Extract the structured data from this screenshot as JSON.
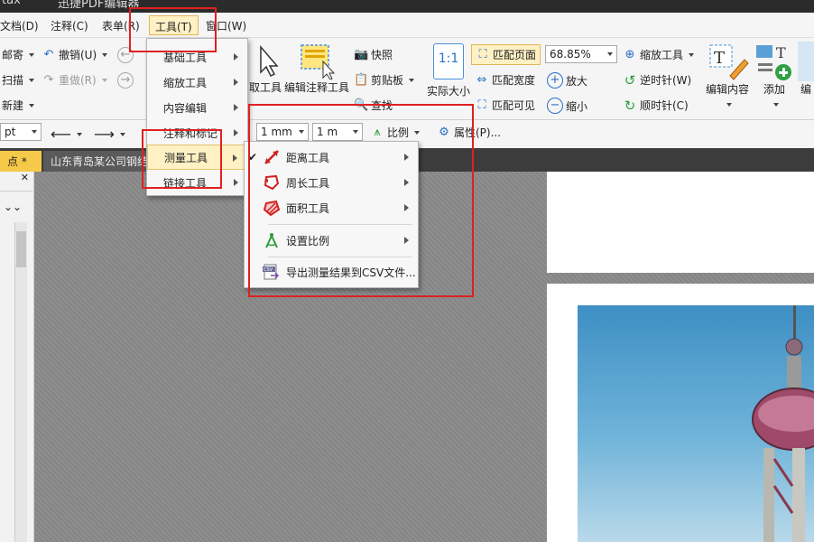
{
  "app": {
    "title": "迅捷PDF编辑器",
    "title_left": "tax"
  },
  "menubar": {
    "items": [
      "文档(D)",
      "注释(C)",
      "表单(R)",
      "工具(T)",
      "窗口(W)"
    ],
    "active": "工具(T)"
  },
  "ribbon": {
    "row1": {
      "mail": "邮寄",
      "undo": "撤销(U)",
      "snapshot": "快照",
      "fit_page": "匹配页面",
      "zoom": "68.85%",
      "zoom_tool": "缩放工具"
    },
    "row2": {
      "scan": "扫描",
      "redo": "重做(R)",
      "clipboard": "剪贴板",
      "fit_width": "匹配宽度",
      "zoom_in": "放大",
      "rotate_ccw": "逆时针(W)"
    },
    "row3": {
      "new": "新建",
      "find": "查找",
      "fit_visible": "匹配可见",
      "zoom_out": "缩小",
      "rotate_cw": "顺时针(C)"
    },
    "big": {
      "select_tool_partial": "取工具",
      "edit_annot": "编辑注释工具",
      "actual_size": "实际大小",
      "edit_content": "编辑内容",
      "add": "添加",
      "edit_more": "编"
    },
    "toolbar2": {
      "unit": "pt",
      "measure_a": "1 mm",
      "measure_b": "1 m",
      "scale": "比例",
      "properties": "属性(P)..."
    }
  },
  "tabs": [
    {
      "label": "点 *"
    },
    {
      "label": "山东青岛某公司钢结"
    }
  ],
  "tools_menu": {
    "items": [
      "基础工具",
      "缩放工具",
      "内容编辑",
      "注释和标记",
      "测量工具",
      "链接工具"
    ],
    "highlighted": "测量工具"
  },
  "measure_menu": {
    "items": [
      {
        "label": "距离工具",
        "checked": true,
        "icon": "distance-icon"
      },
      {
        "label": "周长工具",
        "checked": false,
        "icon": "perimeter-icon"
      },
      {
        "label": "面积工具",
        "checked": false,
        "icon": "area-icon"
      },
      {
        "label": "设置比例",
        "checked": false,
        "icon": "compass-icon"
      },
      {
        "label": "导出测量结果到CSV文件...",
        "checked": false,
        "icon": "csv-export-icon"
      }
    ]
  },
  "colors": {
    "highlight": "#fff1c4",
    "annotation_red": "#e02020",
    "canvas": "#8a8a8a",
    "tab_active": "#f7c948"
  }
}
